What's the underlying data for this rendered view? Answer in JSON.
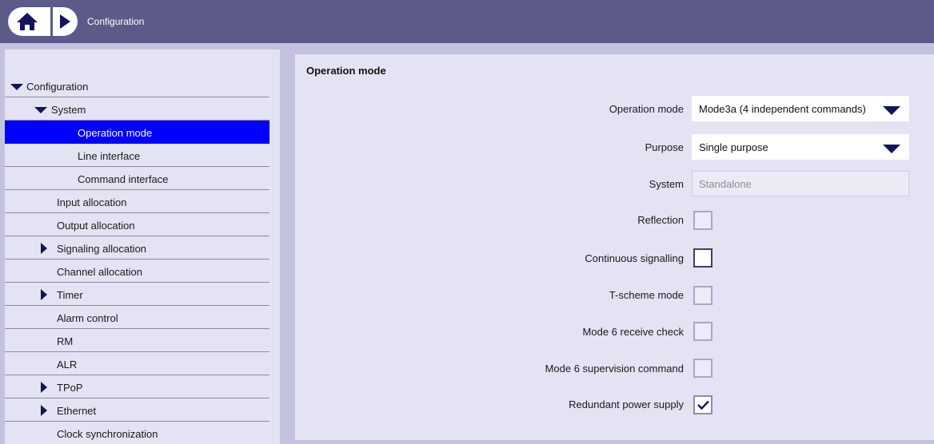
{
  "header": {
    "title": "Configuration",
    "home_icon": "home-icon",
    "forward_icon": "play-icon"
  },
  "sidebar": {
    "items": [
      {
        "label": "Configuration",
        "expanded": true
      },
      {
        "label": "System",
        "expanded": true
      },
      {
        "label": "Operation mode",
        "selected": true
      },
      {
        "label": "Line interface"
      },
      {
        "label": "Command interface"
      },
      {
        "label": "Input allocation"
      },
      {
        "label": "Output allocation"
      },
      {
        "label": "Signaling allocation",
        "expanded": false
      },
      {
        "label": "Channel allocation"
      },
      {
        "label": "Timer",
        "expanded": false
      },
      {
        "label": "Alarm control"
      },
      {
        "label": "RM"
      },
      {
        "label": "ALR"
      },
      {
        "label": "TPoP",
        "expanded": false
      },
      {
        "label": "Ethernet",
        "expanded": false
      },
      {
        "label": "Clock synchronization"
      }
    ]
  },
  "main": {
    "title": "Operation mode",
    "fields": {
      "operation_mode": {
        "label": "Operation mode",
        "value": "Mode3a (4 independent commands)"
      },
      "purpose": {
        "label": "Purpose",
        "value": "Single purpose"
      },
      "system": {
        "label": "System",
        "value": "Standalone"
      },
      "reflection": {
        "label": "Reflection",
        "checked": false
      },
      "continuous_signalling": {
        "label": "Continuous signalling",
        "checked": false
      },
      "t_scheme_mode": {
        "label": "T-scheme mode",
        "checked": false
      },
      "mode6_receive_check": {
        "label": "Mode 6 receive check",
        "checked": false
      },
      "mode6_supervision_command": {
        "label": "Mode 6 supervision command",
        "checked": false
      },
      "redundant_power_supply": {
        "label": "Redundant power supply",
        "checked": true
      }
    }
  },
  "colors": {
    "header_bg": "#5c5a8a",
    "page_bg": "#c3c3e0",
    "panel_bg": "#e3e3f3",
    "selected_bg": "#0000ff",
    "arrow": "#14145a"
  }
}
